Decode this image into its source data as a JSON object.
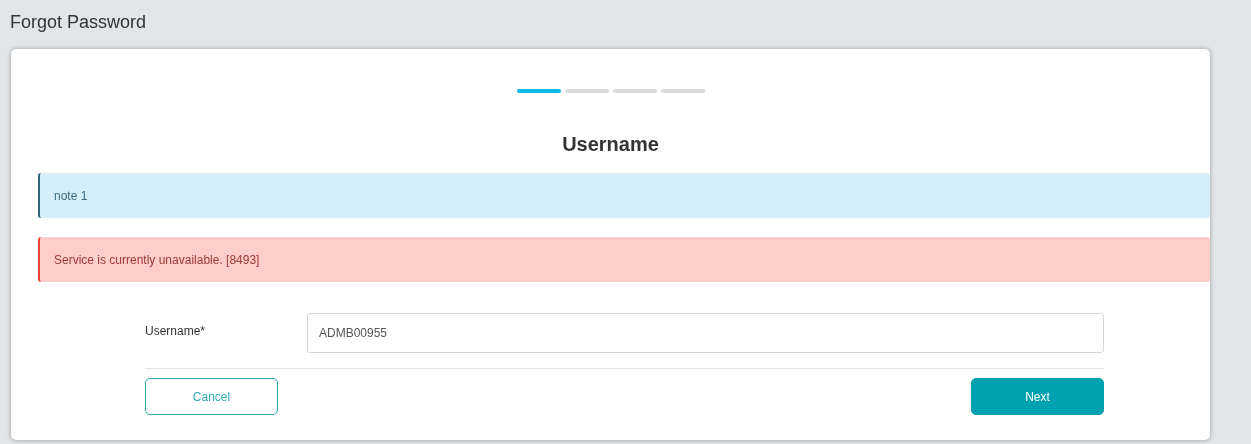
{
  "page_title": "Forgot Password",
  "steps": [
    {
      "active": true
    },
    {
      "active": false
    },
    {
      "active": false
    },
    {
      "active": false
    }
  ],
  "heading": "Username",
  "alerts": [
    {
      "kind": "info",
      "text": "note 1"
    },
    {
      "kind": "error",
      "text": "Service is currently unavailable. [8493]"
    }
  ],
  "field": {
    "label": "Username*",
    "value": "ADMB00955"
  },
  "buttons": [
    {
      "kind": "secondary",
      "label": "Cancel"
    },
    {
      "kind": "primary",
      "label": "Next"
    }
  ]
}
